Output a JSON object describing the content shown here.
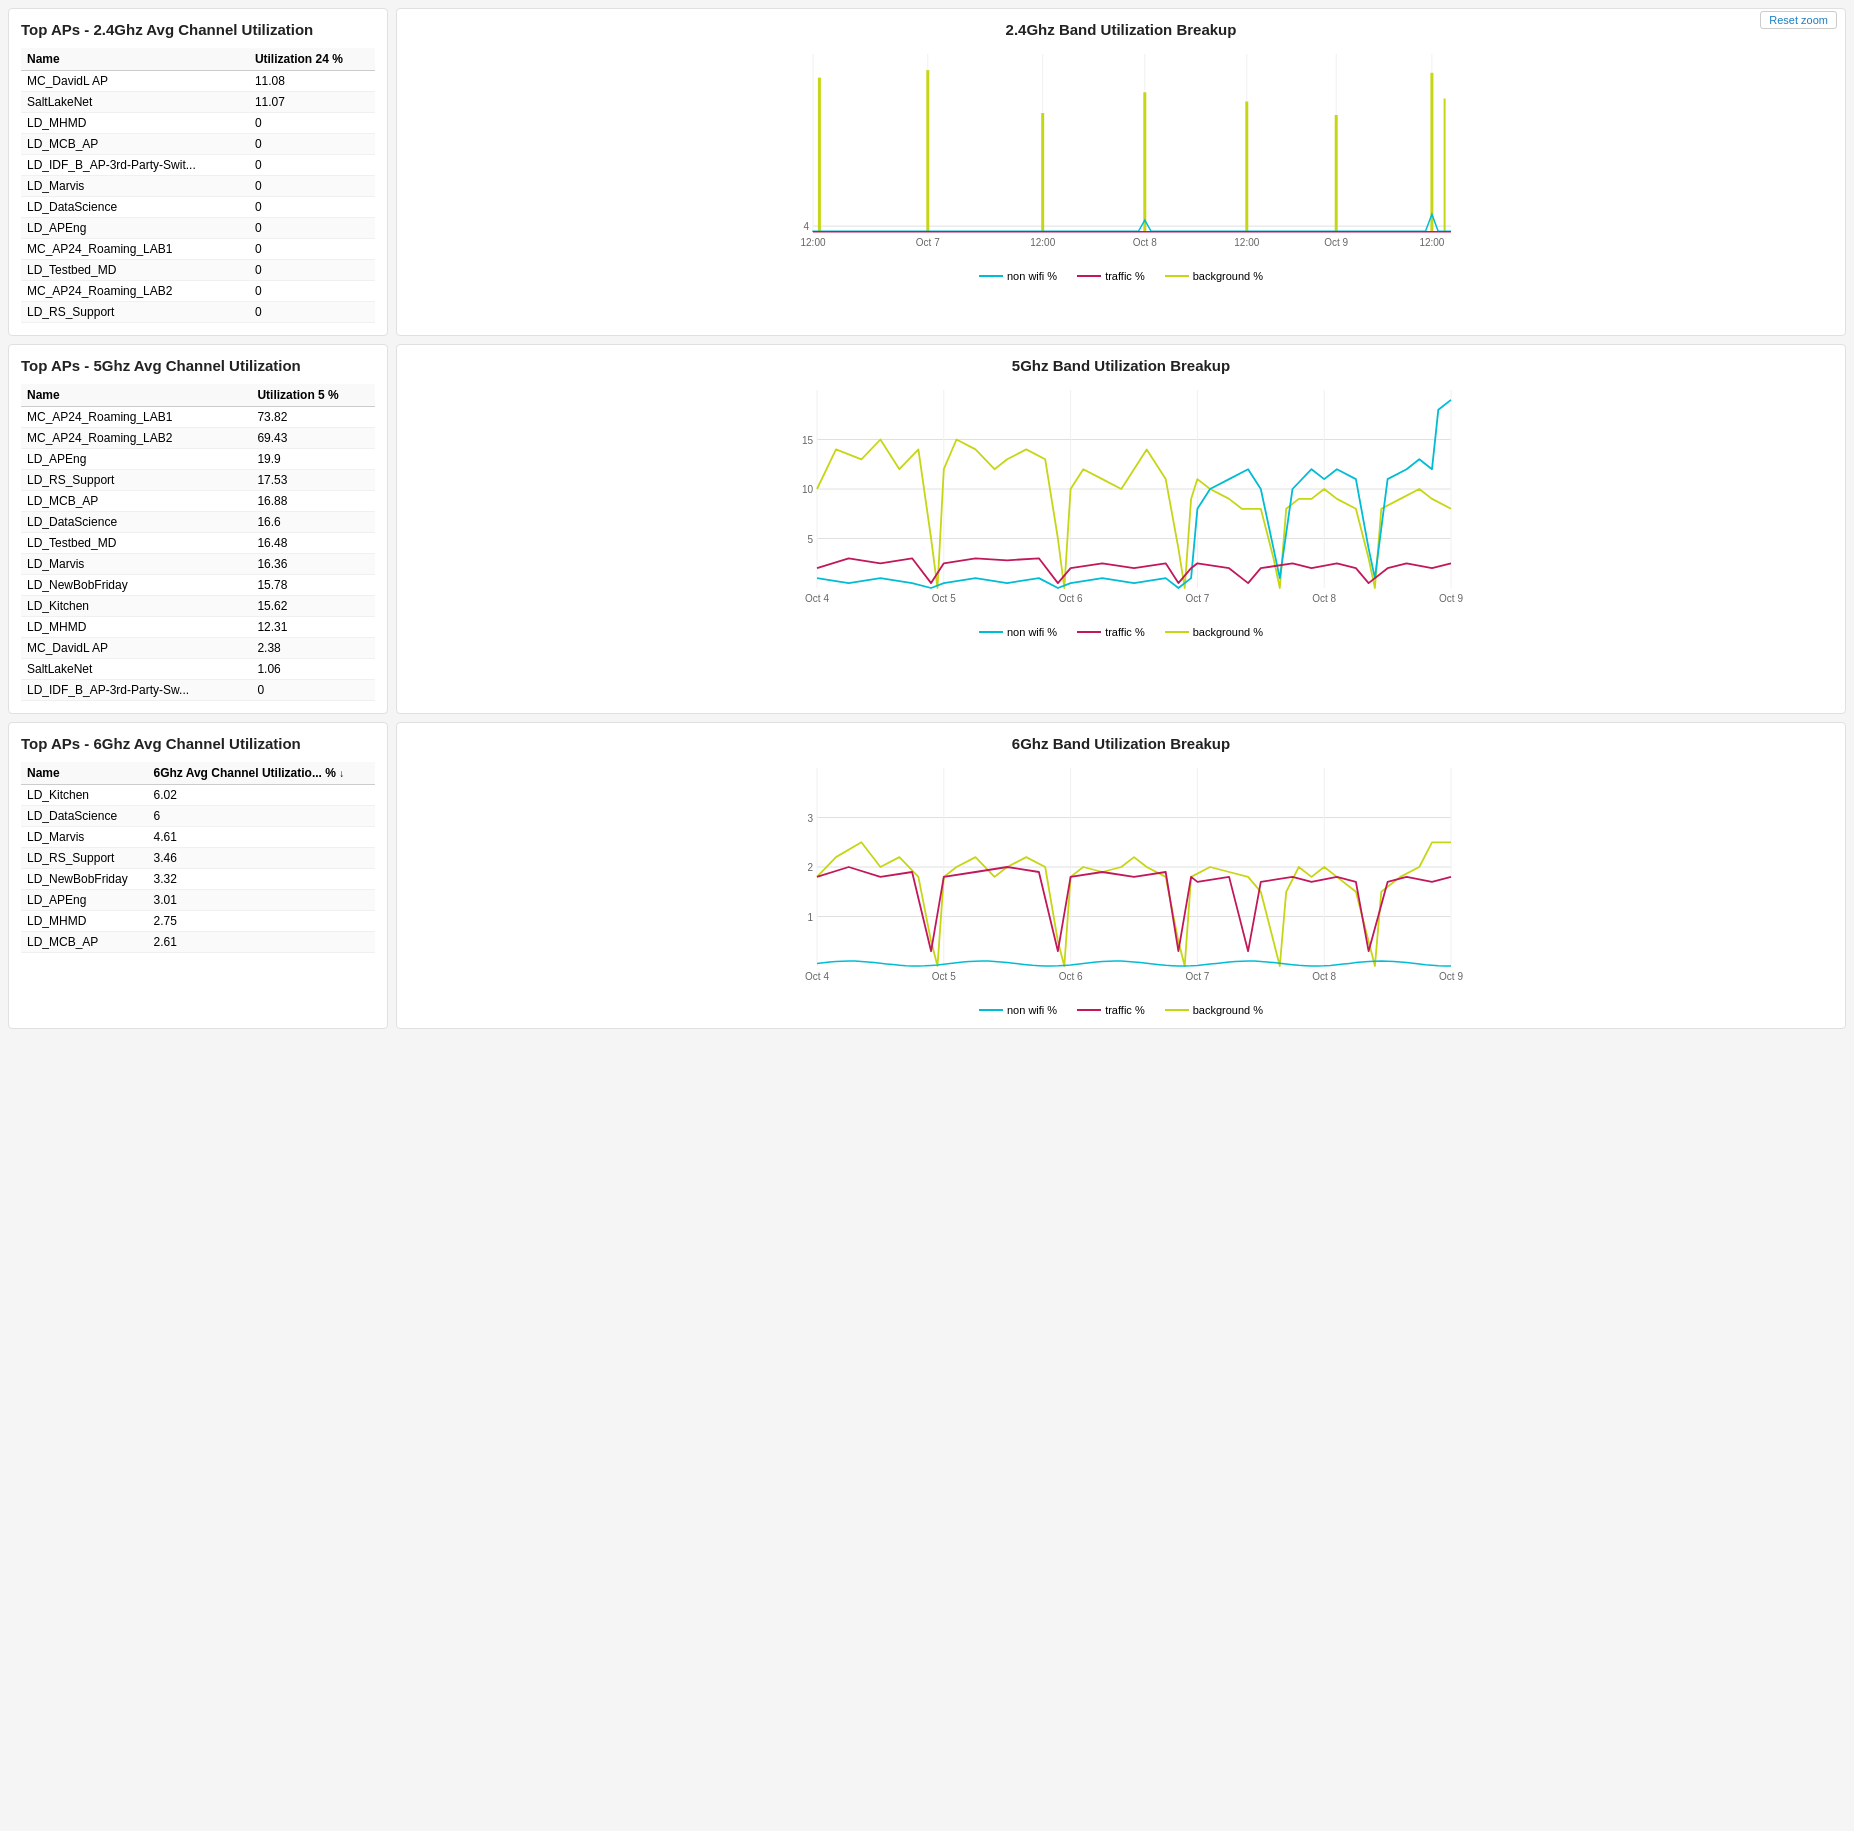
{
  "section24": {
    "title": "Top APs - 2.4Ghz Avg Channel Utilization",
    "col1": "Name",
    "col2": "Utilization 24 %",
    "rows": [
      {
        "name": "MC_DavidL AP",
        "value": "11.08"
      },
      {
        "name": "SaltLakeNet",
        "value": "11.07"
      },
      {
        "name": "LD_MHMD",
        "value": "0"
      },
      {
        "name": "LD_MCB_AP",
        "value": "0"
      },
      {
        "name": "LD_IDF_B_AP-3rd-Party-Swit...",
        "value": "0"
      },
      {
        "name": "LD_Marvis",
        "value": "0"
      },
      {
        "name": "LD_DataScience",
        "value": "0"
      },
      {
        "name": "LD_APEng",
        "value": "0"
      },
      {
        "name": "MC_AP24_Roaming_LAB1",
        "value": "0"
      },
      {
        "name": "LD_Testbed_MD",
        "value": "0"
      },
      {
        "name": "MC_AP24_Roaming_LAB2",
        "value": "0"
      },
      {
        "name": "LD_RS_Support",
        "value": "0"
      }
    ],
    "chart_title": "2.4Ghz Band Utilization Breakup",
    "reset_zoom": "Reset zoom",
    "legend": [
      "non wifi %",
      "traffic %",
      "background %"
    ]
  },
  "section5": {
    "title": "Top APs - 5Ghz Avg Channel Utilization",
    "col1": "Name",
    "col2": "Utilization 5 %",
    "rows": [
      {
        "name": "MC_AP24_Roaming_LAB1",
        "value": "73.82"
      },
      {
        "name": "MC_AP24_Roaming_LAB2",
        "value": "69.43"
      },
      {
        "name": "LD_APEng",
        "value": "19.9"
      },
      {
        "name": "LD_RS_Support",
        "value": "17.53"
      },
      {
        "name": "LD_MCB_AP",
        "value": "16.88"
      },
      {
        "name": "LD_DataScience",
        "value": "16.6"
      },
      {
        "name": "LD_Testbed_MD",
        "value": "16.48"
      },
      {
        "name": "LD_Marvis",
        "value": "16.36"
      },
      {
        "name": "LD_NewBobFriday",
        "value": "15.78"
      },
      {
        "name": "LD_Kitchen",
        "value": "15.62"
      },
      {
        "name": "LD_MHMD",
        "value": "12.31"
      },
      {
        "name": "MC_DavidL AP",
        "value": "2.38"
      },
      {
        "name": "SaltLakeNet",
        "value": "1.06"
      },
      {
        "name": "LD_IDF_B_AP-3rd-Party-Sw...",
        "value": "0"
      }
    ],
    "chart_title": "5Ghz Band Utilization Breakup",
    "legend": [
      "non wifi %",
      "traffic %",
      "background %"
    ]
  },
  "section6": {
    "title": "Top APs - 6Ghz Avg Channel Utilization",
    "col1": "Name",
    "col2": "6Ghz Avg Channel Utilizatio... %",
    "rows": [
      {
        "name": "LD_Kitchen",
        "value": "6.02"
      },
      {
        "name": "LD_DataScience",
        "value": "6"
      },
      {
        "name": "LD_Marvis",
        "value": "4.61"
      },
      {
        "name": "LD_RS_Support",
        "value": "3.46"
      },
      {
        "name": "LD_NewBobFriday",
        "value": "3.32"
      },
      {
        "name": "LD_APEng",
        "value": "3.01"
      },
      {
        "name": "LD_MHMD",
        "value": "2.75"
      },
      {
        "name": "LD_MCB_AP",
        "value": "2.61"
      }
    ],
    "chart_title": "6Ghz Band Utilization Breakup",
    "legend": [
      "non wifi %",
      "traffic %",
      "background %"
    ]
  },
  "colors": {
    "non_wifi": "#00bcd4",
    "traffic": "#c2185b",
    "background": "#c6d614"
  }
}
